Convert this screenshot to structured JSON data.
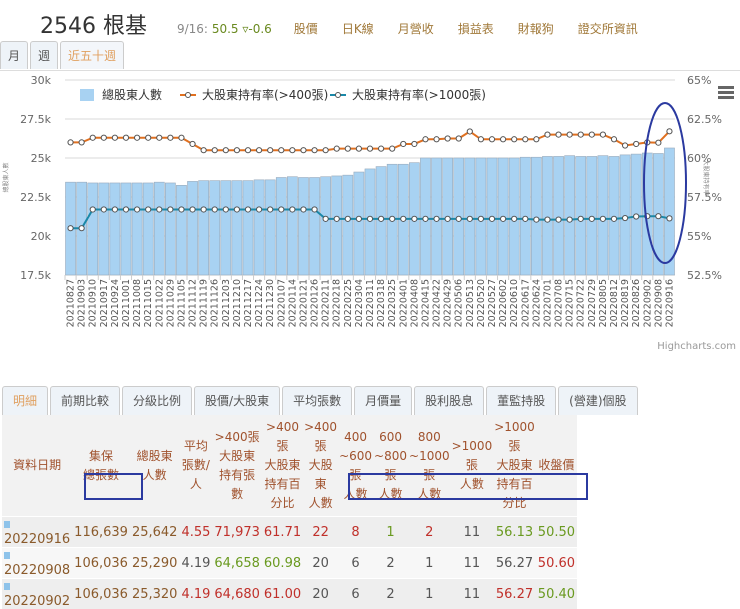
{
  "header": {
    "code_name": "2546 根基",
    "date": "9/16:",
    "price": "50.5",
    "change": "▿-0.6",
    "nav": [
      "股價",
      "日K線",
      "月營收",
      "損益表",
      "財報狗",
      "證交所資訊"
    ]
  },
  "period_tabs": [
    "月",
    "週",
    "近五十週"
  ],
  "chart_data": {
    "type": "bar+line",
    "legend": [
      "總股東人數",
      "大股東持有率(>400張)",
      "大股東持有率(>1000張)"
    ],
    "legend_position": "top",
    "ylabel_left": "總股東人數",
    "ylabel_right": "大股東持有率",
    "yleft_ticks": [
      "30k",
      "27.5k",
      "25k",
      "22.5k",
      "20k",
      "17.5k"
    ],
    "yleft_range": [
      17500,
      30000
    ],
    "yright_ticks": [
      "65%",
      "62.5%",
      "60%",
      "57.5%",
      "55%",
      "52.5%"
    ],
    "yright_range": [
      52.5,
      65
    ],
    "categories": [
      "20210827",
      "20210903",
      "20210910",
      "20210917",
      "20210924",
      "20211001",
      "20211008",
      "20211015",
      "20211022",
      "20211029",
      "20211105",
      "20211112",
      "20211119",
      "20211126",
      "20211203",
      "20211210",
      "20211217",
      "20211224",
      "20211230",
      "20220107",
      "20220114",
      "20220121",
      "20220126",
      "20220211",
      "20220218",
      "20220225",
      "20220304",
      "20220311",
      "20220318",
      "20220325",
      "20220401",
      "20220408",
      "20220415",
      "20220422",
      "20220429",
      "20220506",
      "20220513",
      "20220520",
      "20220527",
      "20220602",
      "20220610",
      "20220617",
      "20220624",
      "20220701",
      "20220708",
      "20220715",
      "20220722",
      "20220729",
      "20220805",
      "20220812",
      "20220819",
      "20220826",
      "20220902",
      "20220908",
      "20220916"
    ],
    "series": [
      {
        "name": "總股東人數",
        "type": "bar",
        "color": "#a8d2f2",
        "values": [
          23450,
          23450,
          23400,
          23400,
          23400,
          23400,
          23400,
          23400,
          23450,
          23400,
          23250,
          23500,
          23550,
          23550,
          23550,
          23550,
          23550,
          23600,
          23600,
          23750,
          23800,
          23750,
          23750,
          23800,
          23850,
          23900,
          24100,
          24300,
          24450,
          24600,
          24600,
          24700,
          25000,
          25000,
          25000,
          25000,
          25000,
          25000,
          25000,
          25000,
          25000,
          25050,
          25050,
          25100,
          25100,
          25150,
          25100,
          25100,
          25150,
          25100,
          25200,
          25250,
          25320,
          25290,
          25642
        ]
      },
      {
        "name": "大股東持有率(>400張)",
        "type": "line",
        "color": "#e07020",
        "values": [
          61.0,
          61.0,
          61.3,
          61.3,
          61.3,
          61.3,
          61.3,
          61.3,
          61.3,
          61.3,
          61.3,
          60.9,
          60.5,
          60.5,
          60.5,
          60.5,
          60.5,
          60.5,
          60.5,
          60.5,
          60.5,
          60.5,
          60.5,
          60.5,
          60.6,
          60.6,
          60.6,
          60.6,
          60.6,
          60.6,
          60.9,
          60.9,
          61.2,
          61.2,
          61.25,
          61.25,
          61.7,
          61.2,
          61.2,
          61.2,
          61.2,
          61.2,
          61.2,
          61.5,
          61.5,
          61.5,
          61.5,
          61.5,
          61.5,
          61.2,
          60.8,
          60.9,
          61.0,
          60.98,
          61.71
        ]
      },
      {
        "name": "大股東持有率(>1000張)",
        "type": "line",
        "color": "#1a88a8",
        "values": [
          55.5,
          55.5,
          56.7,
          56.7,
          56.7,
          56.7,
          56.7,
          56.7,
          56.7,
          56.7,
          56.7,
          56.7,
          56.7,
          56.7,
          56.7,
          56.7,
          56.7,
          56.7,
          56.7,
          56.7,
          56.7,
          56.7,
          56.7,
          56.1,
          56.1,
          56.1,
          56.1,
          56.1,
          56.1,
          56.1,
          56.1,
          56.1,
          56.1,
          56.1,
          56.1,
          56.1,
          56.1,
          56.1,
          56.1,
          56.1,
          56.1,
          56.1,
          56.05,
          56.05,
          56.05,
          56.05,
          56.1,
          56.1,
          56.1,
          56.1,
          56.15,
          56.25,
          56.27,
          56.27,
          56.13
        ]
      }
    ]
  },
  "credit": "Highcharts.com",
  "bottom_tabs": [
    "明細",
    "前期比較",
    "分級比例",
    "股價/大股東",
    "平均張數",
    "月價量",
    "股利股息",
    "董監持股",
    "(營建)個股"
  ],
  "table": {
    "headers": [
      [
        "資料日期"
      ],
      [
        "集保",
        "總張數"
      ],
      [
        "總股東",
        "人數"
      ],
      [
        "平均",
        "張數/人"
      ],
      [
        ">400張",
        "大股東",
        "持有張數"
      ],
      [
        ">400張",
        "大股東",
        "持有百分比"
      ],
      [
        ">400張",
        "大股東",
        "人數"
      ],
      [
        "400",
        "~600張",
        "人數"
      ],
      [
        "600",
        "~800張",
        "人數"
      ],
      [
        "800",
        "~1000張",
        "人數"
      ],
      [
        ">1000張",
        "人數"
      ],
      [
        ">1000張",
        "大股東",
        "持有百分比"
      ],
      [
        "收盤價"
      ]
    ],
    "rows": [
      {
        "cells": [
          "20220916",
          "116,639",
          "25,642",
          "4.55",
          "71,973",
          "61.71",
          "22",
          "8",
          "1",
          "2",
          "11",
          "56.13",
          "50.50"
        ],
        "colors": [
          "b",
          "b",
          "b",
          "r",
          "r",
          "r",
          "r",
          "r",
          "g",
          "r",
          "k",
          "g",
          "g"
        ]
      },
      {
        "cells": [
          "20220908",
          "106,036",
          "25,290",
          "4.19",
          "64,658",
          "60.98",
          "20",
          "6",
          "2",
          "1",
          "11",
          "56.27",
          "50.60"
        ],
        "colors": [
          "b",
          "b",
          "b",
          "k",
          "g",
          "g",
          "k",
          "k",
          "k",
          "k",
          "k",
          "k",
          "r"
        ]
      },
      {
        "cells": [
          "20220902",
          "106,036",
          "25,320",
          "4.19",
          "64,680",
          "61.00",
          "20",
          "6",
          "2",
          "1",
          "11",
          "56.27",
          "50.40"
        ],
        "colors": [
          "b",
          "b",
          "b",
          "r",
          "r",
          "r",
          "k",
          "k",
          "k",
          "k",
          "k",
          "r",
          "g"
        ]
      }
    ]
  },
  "palette": {
    "b": "#8a5a2b",
    "r": "#c0302a",
    "g": "#6a9a20",
    "k": "#555555"
  }
}
